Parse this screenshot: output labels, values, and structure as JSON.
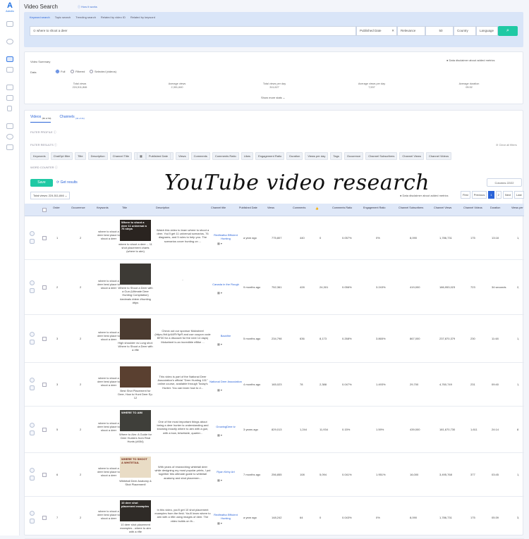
{
  "app": {
    "logo_text": "Aubolio",
    "title": "Video Search",
    "howto": "How it works"
  },
  "search": {
    "tabs": [
      "Keyword search",
      "Topic search",
      "Trending search",
      "Related by video ID",
      "Related by keyword"
    ],
    "query": "where to shoot a deer",
    "published": "Published Date",
    "sort": "Relevance",
    "count": "50",
    "country": "Country",
    "language": "Language"
  },
  "summary": {
    "title": "Video Summary",
    "disclaimer": "Data disclaimer about added metrics",
    "data_label": "Data",
    "radios": [
      "Full",
      "Filtered",
      "Selected (videos)"
    ],
    "stats": [
      {
        "label": "Total views",
        "value": "224,511,846"
      },
      {
        "label": "Average views",
        "value": "2,301,640"
      },
      {
        "label": "Total views per day",
        "value": "311,627"
      },
      {
        "label": "Average views per day",
        "value": "7,537"
      },
      {
        "label": "Average duration",
        "value": "05:32"
      }
    ],
    "show_more": "Show more stats"
  },
  "results": {
    "tabs": [
      {
        "label": "Videos",
        "count": "(50 of 50)"
      },
      {
        "label": "Channels",
        "count": "(41 of 41)"
      }
    ],
    "filter_profile": "FILTER PROFILE",
    "filter_results": "FILTER RESULTS",
    "clear": "Clear all filters",
    "chips": [
      "Keywords",
      "ChatGpt filter",
      "Title",
      "Description",
      "Channel Title",
      "Published Date",
      "Views",
      "Comments",
      "Comments Ratio",
      "Likes",
      "Engagement Ratio",
      "Duration",
      "Views per day",
      "Tags",
      "Occurence",
      "Channel Subscribers",
      "Channel Views",
      "Channel Videos"
    ],
    "word_counter": "WORD COUNTER",
    "save": "Save",
    "get_results": "Get results",
    "columns": "Columns 22/22",
    "total_views": "Total views: 224,511,846",
    "disclaimer": "Data disclaimer about added metrics",
    "pager": [
      "First",
      "Previous",
      "1",
      "2",
      "Next",
      "Last"
    ]
  },
  "watermark": "YouTube video research",
  "table": {
    "headers": [
      "Order",
      "Occurrence",
      "Keywords",
      "Title",
      "Description",
      "Channel title",
      "Published Date",
      "Views",
      "Comments",
      "Comments Ratio",
      "Engagement Ratio",
      "Channel Subscribers",
      "Channel Views",
      "Channel Videos",
      "Duration",
      "Views per"
    ],
    "rows": [
      {
        "order": "1",
        "occ": "2",
        "kw": "where to shoot a deer best place to shoot a deer",
        "thumb": "Where to shoot a deer 11 universal a 76 steps",
        "title": "where to shoot a deer -- 11 shot placement charts (where to aim)",
        "desc": "Watch this video to learn where to shoot a deer. You'll get 11 universal scenarios, 76 diagrams, and 5 rules to help you. The scenarios cover hunting on ...",
        "channel": "Redfeatha Efficient Hunting",
        "pub": "a year ago",
        "views": "775,807",
        "comments": "440",
        "likes": "0",
        "cratio": "0.057%",
        "eratio": "0%",
        "subs": "8,090",
        "cviews": "1,786,731",
        "cvideos": "175",
        "dur": "13:18",
        "vpd": "1,"
      },
      {
        "order": "2",
        "occ": "2",
        "kw": "where to shoot a deer best place to shoot a deer",
        "thumb": "",
        "title": "Where to Shoot a Deer with a Gun (Ultimate Deer Hunting Compilation) #animals #deer #hunting #tips",
        "desc": "-",
        "channel": "Canada in the Rough",
        "pub": "9 months ago",
        "views": "752,361",
        "comments": "428",
        "likes": "24,301",
        "cratio": "0.056%",
        "eratio": "3.243%",
        "subs": "419,000",
        "cviews": "186,953,023",
        "cvideos": "723",
        "dur": "34 seconds",
        "vpd": "2,"
      },
      {
        "order": "3",
        "occ": "2",
        "kw": "where to shoot a deer best place to shoot a deer",
        "thumb": "",
        "title": "High shoulder vs Lung shot: Where to Shoot a Deer with a rifle",
        "desc": "Check out our sponsor Mokwheel (https://bit.ly/44RY9pR and use coupon code BF30 for a discount for the next 14 days) Mokwheel is an incredible eBike ...",
        "channel": "Backfire",
        "pub": "5 months ago",
        "views": "234,798",
        "comments": "636",
        "likes": "8,173",
        "cratio": "0.268%",
        "eratio": "3.865%",
        "subs": "867,000",
        "cviews": "237,870,379",
        "cvideos": "230",
        "dur": "11:48",
        "vpd": "1,"
      },
      {
        "order": "3",
        "occ": "2",
        "kw": "where to shoot a deer best place to shoot a deer",
        "thumb": "",
        "title": "Best Shot Placement for Deer, How to Hunt Deer Ep. 12",
        "desc": "This video is part of the National Deer Association's official \"Deer Hunting 101\" online course, available through Today's Hunter. You can learn how to d...",
        "channel": "National Deer Association",
        "pub": "4 months ago",
        "views": "165,023",
        "comments": "78",
        "likes": "2,388",
        "cratio": "0.047%",
        "eratio": "1.493%",
        "subs": "29,700",
        "cviews": "4,760,749",
        "cvideos": "231",
        "dur": "09:40",
        "vpd": "1,"
      },
      {
        "order": "5",
        "occ": "2",
        "kw": "where to shoot a deer best place to shoot a deer",
        "thumb": "WHERE TO AIM",
        "title": "Where to Aim: A Guide for Deer Hunters from Real Hunts (#454)",
        "desc": "One of the most important things about being a deer hunter is understanding and knowing exactly where to aim with a gun, with a bow, brisetside, quarter...",
        "channel": "GrowingDeer.tv",
        "pub": "3 years ago",
        "views": "829,013",
        "comments": "1,244",
        "likes": "11,934",
        "cratio": "0.15%",
        "eratio": "1.59%",
        "subs": "439,000",
        "cviews": "181,670,730",
        "cvideos": "1,611",
        "dur": "24:14",
        "vpd": "8"
      },
      {
        "order": "6",
        "occ": "2",
        "kw": "where to shoot a deer best place to shoot a deer",
        "thumb": "WHERE TO SHOOT A WHITETAIL",
        "title": "Whitetail Deer Anatomy & Shot Placement!",
        "desc": "With years of researching whitetail deer while designing my most popular prints, I put together this ultimate guide to whitetail anatomy and shot placemen...",
        "channel": "Ryan Kirby Art",
        "pub": "7 months ago",
        "views": "256,855",
        "comments": "108",
        "likes": "5,094",
        "cratio": "0.041%",
        "eratio": "1.951%",
        "subs": "16,000",
        "cviews": "3,495,768",
        "cvideos": "377",
        "dur": "03:45",
        "vpd": "1,"
      },
      {
        "order": "7",
        "occ": "2",
        "kw": "where to shoot a deer best place to shoot a deer",
        "thumb": "10 deer shot placement examples",
        "title": "10 deer shot placement examples - where to aim with a rifle",
        "desc": "In this video, you'll get 10 shot placement examples from the field. You'll learn where to aim with a rifle using images of deer. The video builds on th...",
        "channel": "Redfeatha Efficient Hunting",
        "pub": "a year ago",
        "views": "148,242",
        "comments": "64",
        "likes": "0",
        "cratio": "0.043%",
        "eratio": "0%",
        "subs": "8,090",
        "cviews": "1,786,731",
        "cvideos": "175",
        "dur": "05:39",
        "vpd": "3,"
      }
    ]
  }
}
